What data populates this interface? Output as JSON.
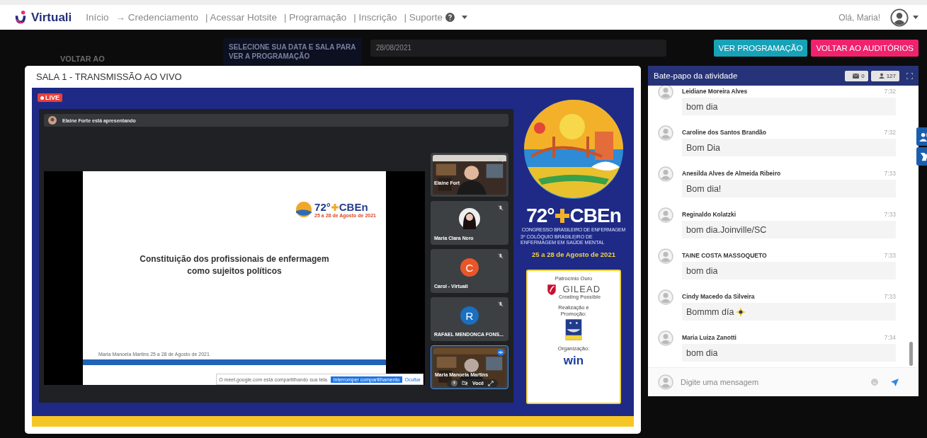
{
  "nav": {
    "brand": "Virtuali",
    "links": [
      "Início",
      "→ Credenciamento",
      "| Acessar Hotsite",
      "| Programação",
      "| Inscrição",
      "| Suporte"
    ],
    "greeting": "Olá, Maria!"
  },
  "backdrop": {
    "back_link": "VOLTAR AO",
    "notice": "SELECIONE SUA DATA E SALA PARA VER A PROGRAMAÇÃO",
    "date": "28/08/2021"
  },
  "actions": [
    {
      "label": "VER PROGRAMAÇÃO",
      "color": "#17a2b8"
    },
    {
      "label": "VOLTAR AO AUDITÓRIOS",
      "color": "#f0226e"
    }
  ],
  "stream": {
    "title": "SALA 1 - TRANSMISSÃO AO VIVO",
    "live_badge": "LIVE",
    "presenter_bar": "Elaine Forte está apresentando",
    "slide": {
      "logo_number": "72°",
      "logo_name": "CBEn",
      "logo_dates": "25 a 28 de Agosto de 2021",
      "title_lines": [
        "Constituição dos profissionais de enfermagem",
        "como sujeitos políticos"
      ],
      "footer": "Maria Manoela Martins 25 a 28 de Agosto de 2021"
    },
    "share_bar": {
      "message": "O meet.google.com está compartilhando sua tela.",
      "stop_button": "Interromper compartilhamento",
      "hide_button": "Ocultar"
    },
    "participants": [
      {
        "name": "Elaine Fort",
        "kind": "camera",
        "muted": true,
        "speaking": false,
        "self": false
      },
      {
        "name": "Maria Clara Nero",
        "muted": true,
        "speaking": false,
        "self": false
      },
      {
        "name": "Carol - Virtuali",
        "kind": "initial",
        "initial": "C",
        "color": "#e8562a",
        "muted": true,
        "speaking": false,
        "self": false
      },
      {
        "name": "RAFAEL MENDONCA FONS...",
        "kind": "initial",
        "initial": "R",
        "color": "#1a6fc0",
        "muted": true,
        "speaking": false,
        "self": false
      },
      {
        "name": "Maria Manoela Martins",
        "kind": "camera",
        "muted": false,
        "speaking": true,
        "self": true
      }
    ],
    "self_label": "Você",
    "banner": {
      "number": "72°",
      "name": "CBEn",
      "subtitle": "CONGRESSO BRASILEIRO DE ENFERMAGEM",
      "colloquium": "3º COLÓQUIO BRASILEIRO DE ENFERMAGEM EM SAÚDE MENTAL",
      "dates": "25 a 28 de Agosto de 2021",
      "sponsor_heading": "Patrocínio Ouro",
      "sponsor": "GILEAD",
      "sponsor_tagline": "Creating Possible",
      "realization": "Realização e Promoção:",
      "organization": "Organização:",
      "organizer": "win"
    }
  },
  "chat": {
    "title": "Bate-papo da atividade",
    "messages_count": "0",
    "people_count": "127",
    "placeholder": "Digite uma mensagem",
    "messages": [
      {
        "name": "Leidiane Moreira Alves",
        "time": "7:32",
        "text": "bom dia",
        "sticker": false
      },
      {
        "name": "Caroline dos Santos Brandão",
        "time": "7:32",
        "text": "Bom Dia",
        "sticker": false
      },
      {
        "name": "Anesilda Alves de Almeida Ribeiro",
        "time": "7:33",
        "text": "Bom dia!",
        "sticker": false
      },
      {
        "name": "Reginaldo Kolatzki",
        "time": "7:33",
        "text": "bom dia.Joinville/SC",
        "sticker": false
      },
      {
        "name": "TAINE COSTA MASSOQUETO",
        "time": "7:33",
        "text": "bom dia",
        "sticker": false
      },
      {
        "name": "Cindy Macedo da Silveira",
        "time": "7:33",
        "text": "Bommm día",
        "sticker": true
      },
      {
        "name": "Maria Luiza Zanotti",
        "time": "7:34",
        "text": "bom dia",
        "sticker": false
      }
    ]
  }
}
